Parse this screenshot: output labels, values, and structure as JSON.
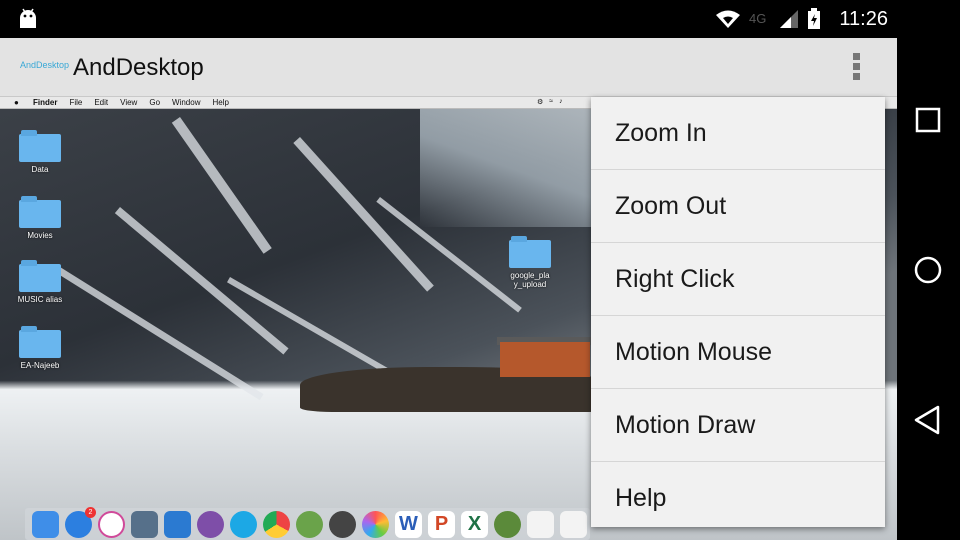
{
  "status_bar": {
    "time": "11:26",
    "network": "4G",
    "icons": [
      "android-icon",
      "wifi-icon",
      "network-4g-icon",
      "signal-icon",
      "battery-icon"
    ]
  },
  "app_bar": {
    "logo_text": "AndDesktop",
    "title": "AndDesktop",
    "overflow_icon": "more-vert-icon"
  },
  "remote_desktop": {
    "menu_bar": {
      "apple_icon": "apple-icon",
      "menus": [
        "Finder",
        "File",
        "Edit",
        "View",
        "Go",
        "Window",
        "Help"
      ]
    },
    "desktop_icons": [
      {
        "label": "Data"
      },
      {
        "label": "Movies"
      },
      {
        "label": "MUSIC alias"
      },
      {
        "label": "EA-Najeeb"
      },
      {
        "label": "google_pla y_upload"
      }
    ],
    "dock_apps": [
      "finder-icon",
      "app-store-icon",
      "itunes-icon",
      "preview-icon",
      "mail-icon",
      "viber-icon",
      "skype-icon",
      "chrome-icon",
      "android-studio-icon",
      "activity-monitor-icon",
      "photos-icon",
      "word-icon",
      "powerpoint-icon",
      "excel-icon",
      "minecraft-icon",
      "java-icon",
      "java2-icon"
    ],
    "dock_badge": "2"
  },
  "popup_menu": {
    "items": [
      {
        "label": "Zoom In"
      },
      {
        "label": "Zoom Out"
      },
      {
        "label": "Right Click"
      },
      {
        "label": "Motion Mouse"
      },
      {
        "label": "Motion Draw"
      },
      {
        "label": "Help"
      }
    ]
  },
  "nav_bar": {
    "buttons": [
      "recents-icon",
      "home-icon",
      "back-icon"
    ]
  },
  "colors": {
    "app_bar_bg": "#e3e3e3",
    "menu_bg": "#f1f1f1",
    "logo_accent": "#39a8d6"
  }
}
